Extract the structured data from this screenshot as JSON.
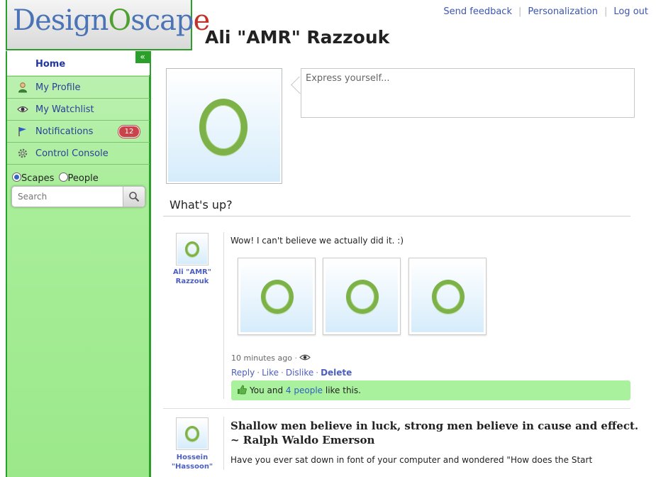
{
  "header": {
    "logo_text": "DesignOscape",
    "links": [
      "Send feedback",
      "Personalization",
      "Log out"
    ],
    "profile_name": "Ali \"AMR\" Razzouk"
  },
  "sidebar": {
    "collapse_glyph": "«",
    "home_label": "Home",
    "items": [
      {
        "label": "My Profile",
        "icon": "user-icon"
      },
      {
        "label": "My Watchlist",
        "icon": "eye-icon"
      },
      {
        "label": "Notifications",
        "icon": "flag-icon",
        "badge": "12"
      },
      {
        "label": "Control Console",
        "icon": "gear-icon"
      }
    ],
    "search_scope": {
      "options": [
        "Scapes",
        "People"
      ],
      "selected": "Scapes"
    },
    "search_placeholder": "Search"
  },
  "status": {
    "placeholder": "Express yourself..."
  },
  "feed": {
    "title": "What's up?",
    "posts": [
      {
        "author": "Ali \"AMR\" Razzouk",
        "text": "Wow! I can't believe we actually did it. :)",
        "time": "10 minutes ago",
        "actions": [
          "Reply",
          "Like",
          "Dislike",
          "Delete"
        ],
        "likes": {
          "prefix": "You and",
          "link": "4 people",
          "suffix": "like this."
        }
      },
      {
        "author": "Hossein \"Hassoon\"",
        "quote_line1": "Shallow men believe in luck, strong men believe in cause and effect.",
        "quote_line2": "~ Ralph Waldo Emerson",
        "text": "Have you ever sat down in font of your computer and wondered \"How does the Start"
      }
    ]
  },
  "colors": {
    "accent_green": "#2aa02a",
    "link_blue": "#3d56b0",
    "badge_red": "#c9444a",
    "like_bar": "#a9f19c"
  }
}
